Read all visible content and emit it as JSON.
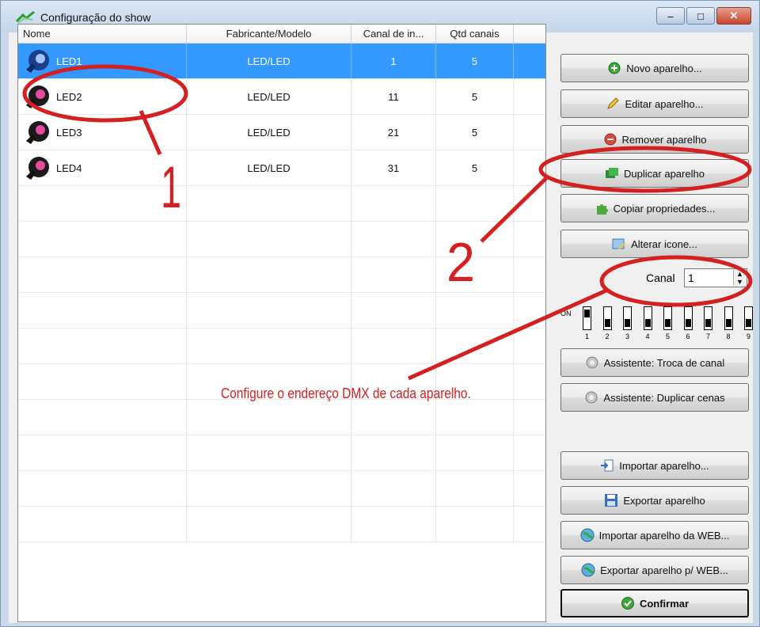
{
  "window": {
    "title": "Configuração do show",
    "controls": {
      "minimize": "‒",
      "maximize": "□",
      "close": "✕"
    }
  },
  "table": {
    "columns": [
      "Nome",
      "Fabricante/Modelo",
      "Canal de in...",
      "Qtd canais"
    ],
    "rows": [
      {
        "name": "LED1",
        "model": "LED/LED",
        "start": "1",
        "count": "5",
        "selected": true
      },
      {
        "name": "LED2",
        "model": "LED/LED",
        "start": "11",
        "count": "5",
        "selected": false
      },
      {
        "name": "LED3",
        "model": "LED/LED",
        "start": "21",
        "count": "5",
        "selected": false
      },
      {
        "name": "LED4",
        "model": "LED/LED",
        "start": "31",
        "count": "5",
        "selected": false
      }
    ]
  },
  "buttons": {
    "novo": "Novo aparelho...",
    "editar": "Editar aparelho...",
    "remover": "Remover aparelho",
    "duplicar": "Duplicar aparelho",
    "copiar": "Copiar propriedades...",
    "alterar": "Alterar icone...",
    "troca": "Assistente: Troca de canal",
    "dup_cenas": "Assistente: Duplicar cenas",
    "importar": "Importar aparelho...",
    "exportar": "Exportar aparelho",
    "importar_web": "Importar aparelho da WEB...",
    "exportar_web": "Exportar aparelho p/ WEB...",
    "confirmar": "Confirmar"
  },
  "canal": {
    "label": "Canal",
    "value": "1"
  },
  "dip": {
    "on_label": "ON",
    "numbers": [
      "1",
      "2",
      "3",
      "4",
      "5",
      "6",
      "7",
      "8",
      "9"
    ]
  },
  "annotations": {
    "one": "1",
    "two": "2",
    "text": "Configure o endereço DMX de cada aparelho."
  },
  "colors": {
    "selection": "#3399ff",
    "annotation": "#d42020"
  }
}
